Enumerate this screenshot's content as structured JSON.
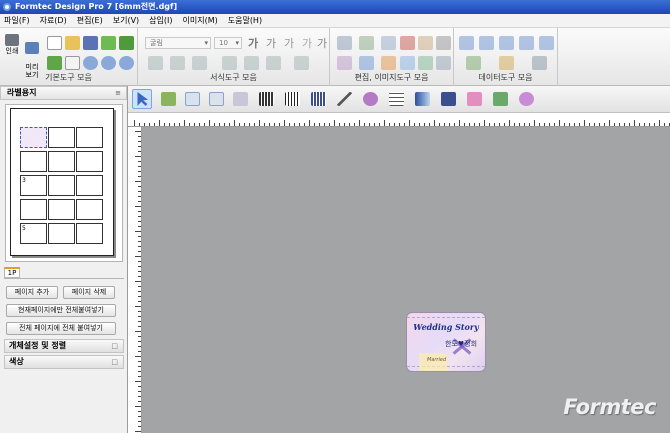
{
  "window": {
    "title": "Formtec Design Pro 7 [6mm전면.dgf]"
  },
  "menu": [
    "파일(F)",
    "자료(D)",
    "편집(E)",
    "보기(V)",
    "삽입(I)",
    "이미지(M)",
    "도움말(H)"
  ],
  "ribbon": {
    "groups": [
      "기본도구 모음",
      "서식도구 모음",
      "편집, 이미지도구 모음",
      "데이터도구 모음"
    ],
    "print_label": "인쇄",
    "preview_label": "미리\n보기",
    "font_value": "굴림",
    "size_value": "10",
    "font_effects": [
      "가",
      "가",
      "가",
      "가",
      "가"
    ]
  },
  "left_panel": {
    "title": "라벨용지",
    "cell_numbers": {
      "row3": "3",
      "row5": "5"
    },
    "tab_label": "1P",
    "buttons": {
      "add_page": "페이지 추가",
      "delete_page": "페이지 삭제",
      "paste_current": "현재페이지에만 전체붙여넣기",
      "paste_all": "전체 페이지에 전체 붙여넣기"
    },
    "sections": [
      "개체설정 및 정렬",
      "색상"
    ]
  },
  "label_design": {
    "title": "Wedding Story",
    "subtitle": "한도♥정희",
    "small": "Married"
  },
  "brand": "Formtec",
  "colors": {
    "titlebar": "#1c48b4",
    "canvas": "#a2a4a6",
    "accent": "#e39b2a"
  }
}
